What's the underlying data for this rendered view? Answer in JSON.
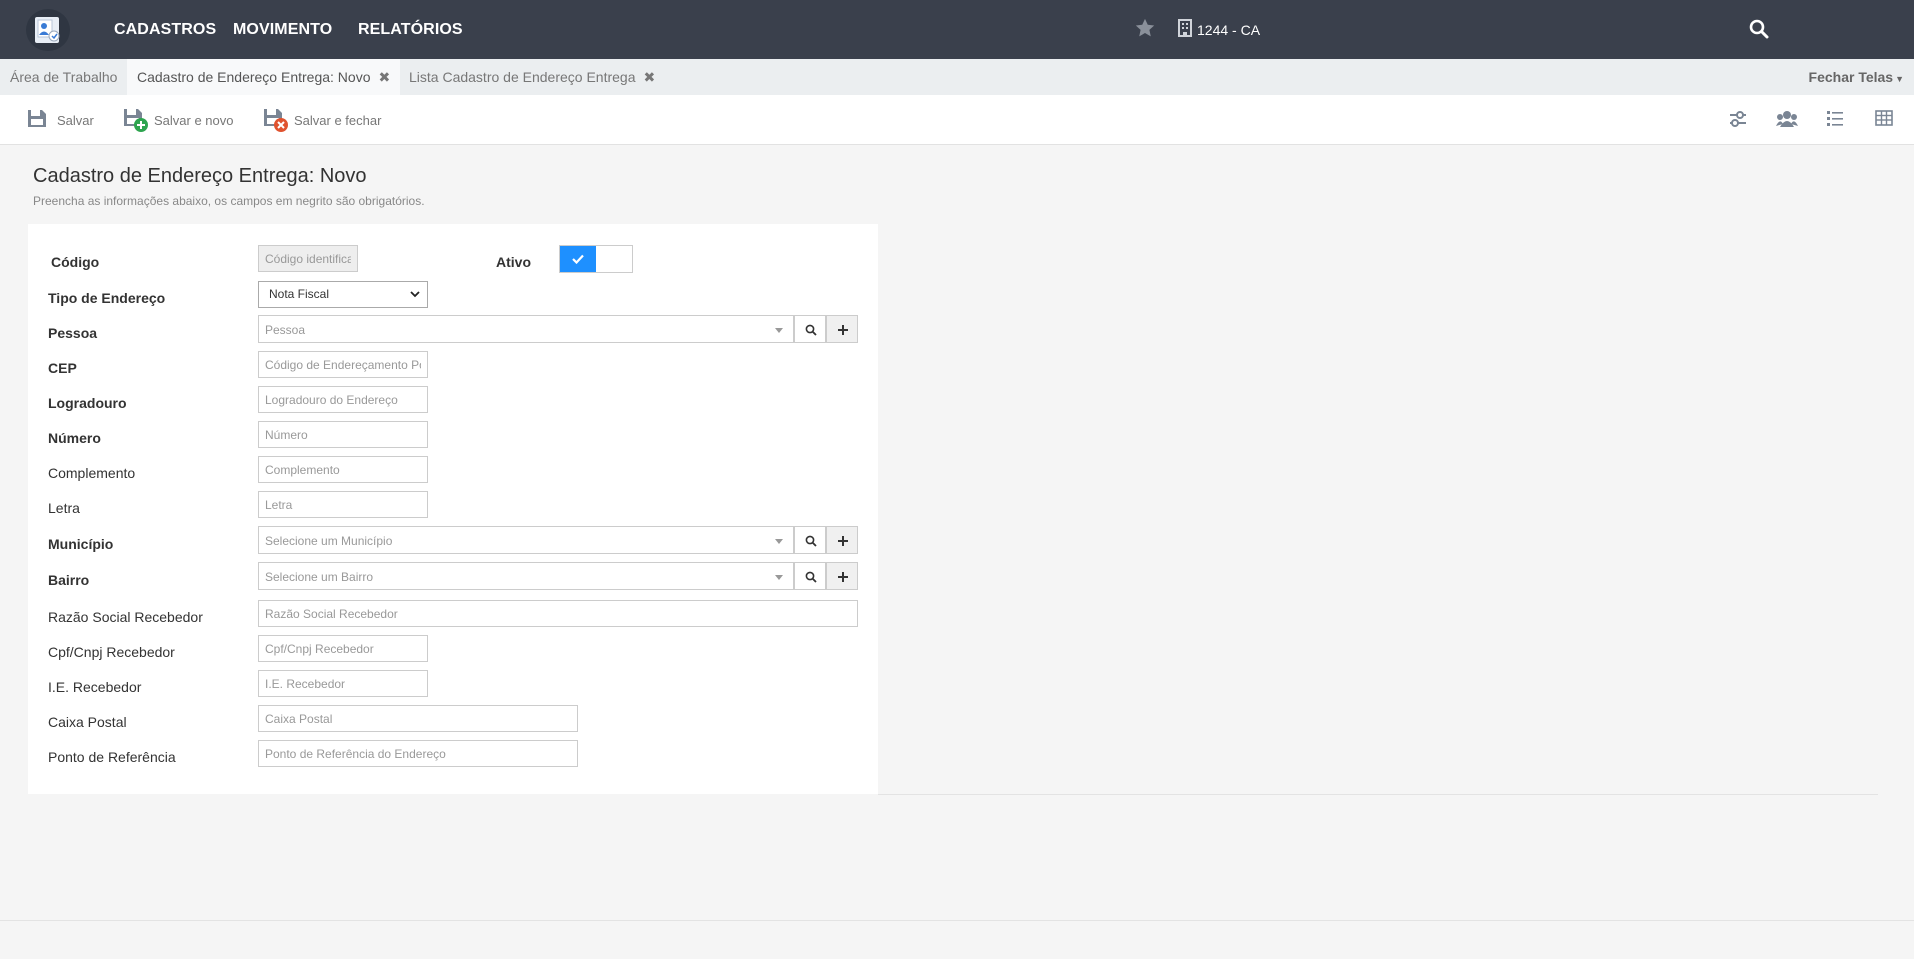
{
  "topbar": {
    "nav": [
      "CADASTROS",
      "MOVIMENTO",
      "RELATÓRIOS"
    ],
    "branch": "1244 - CA"
  },
  "tabs": {
    "items": [
      {
        "label": "Área de Trabalho"
      },
      {
        "label": "Cadastro de Endereço Entrega: Novo",
        "closable": true
      },
      {
        "label": "Lista Cadastro de Endereço Entrega",
        "closable": true
      }
    ],
    "close_all": "Fechar Telas"
  },
  "toolbar": {
    "save": "Salvar",
    "save_new": "Salvar e novo",
    "save_close": "Salvar e fechar"
  },
  "page": {
    "title": "Cadastro de Endereço Entrega: Novo",
    "subtitle": "Preencha as informações abaixo, os campos em negrito são obrigatórios."
  },
  "form": {
    "codigo": {
      "label": "Código",
      "placeholder": "Código identificador"
    },
    "ativo": {
      "label": "Ativo",
      "value": true
    },
    "tipo": {
      "label": "Tipo de Endereço",
      "value": "Nota Fiscal"
    },
    "pessoa": {
      "label": "Pessoa",
      "placeholder": "Pessoa"
    },
    "cep": {
      "label": "CEP",
      "placeholder": "Código de Endereçamento Postal"
    },
    "logradouro": {
      "label": "Logradouro",
      "placeholder": "Logradouro do Endereço"
    },
    "numero": {
      "label": "Número",
      "placeholder": "Número"
    },
    "complemento": {
      "label": "Complemento",
      "placeholder": "Complemento"
    },
    "letra": {
      "label": "Letra",
      "placeholder": "Letra"
    },
    "municipio": {
      "label": "Município",
      "placeholder": "Selecione um Município"
    },
    "bairro": {
      "label": "Bairro",
      "placeholder": "Selecione um Bairro"
    },
    "razao": {
      "label": "Razão Social Recebedor",
      "placeholder": "Razão Social Recebedor"
    },
    "cpf": {
      "label": "Cpf/Cnpj Recebedor",
      "placeholder": "Cpf/Cnpj Recebedor"
    },
    "ie": {
      "label": "I.E. Recebedor",
      "placeholder": "I.E. Recebedor"
    },
    "caixa": {
      "label": "Caixa Postal",
      "placeholder": "Caixa Postal"
    },
    "referencia": {
      "label": "Ponto de Referência",
      "placeholder": "Ponto de Referência do Endereço"
    }
  },
  "icons": {
    "logo": "contact-card-icon",
    "favorite": "star-icon",
    "branch": "building-icon",
    "search": "search-icon",
    "save": "floppy-disk-icon",
    "save_new": "floppy-plus-icon",
    "save_close": "floppy-close-icon",
    "filters": "sliders-icon",
    "users": "users-icon",
    "list": "list-icon",
    "grid": "table-icon"
  },
  "colors": {
    "topbar": "#3a404c",
    "toggle_on": "#1e90ff",
    "add_green": "#2ea44f",
    "close_red": "#e0532f"
  }
}
